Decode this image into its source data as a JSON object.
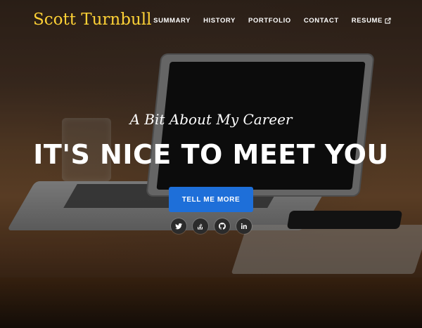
{
  "brand": {
    "name": "Scott Turnbull"
  },
  "nav": {
    "items": [
      {
        "label": "SUMMARY"
      },
      {
        "label": "HISTORY"
      },
      {
        "label": "PORTFOLIO"
      },
      {
        "label": "CONTACT"
      },
      {
        "label": "RESUME",
        "icon": "external-link-icon"
      }
    ]
  },
  "hero": {
    "lead": "A Bit About My Career",
    "heading": "IT'S NICE TO MEET YOU",
    "cta_label": "TELL ME MORE"
  },
  "social": [
    {
      "icon": "twitter-icon"
    },
    {
      "icon": "stack-overflow-icon"
    },
    {
      "icon": "github-icon"
    },
    {
      "icon": "linkedin-icon"
    }
  ],
  "colors": {
    "brand": "#fed136",
    "cta": "#1e6fd9",
    "text": "#ffffff"
  }
}
